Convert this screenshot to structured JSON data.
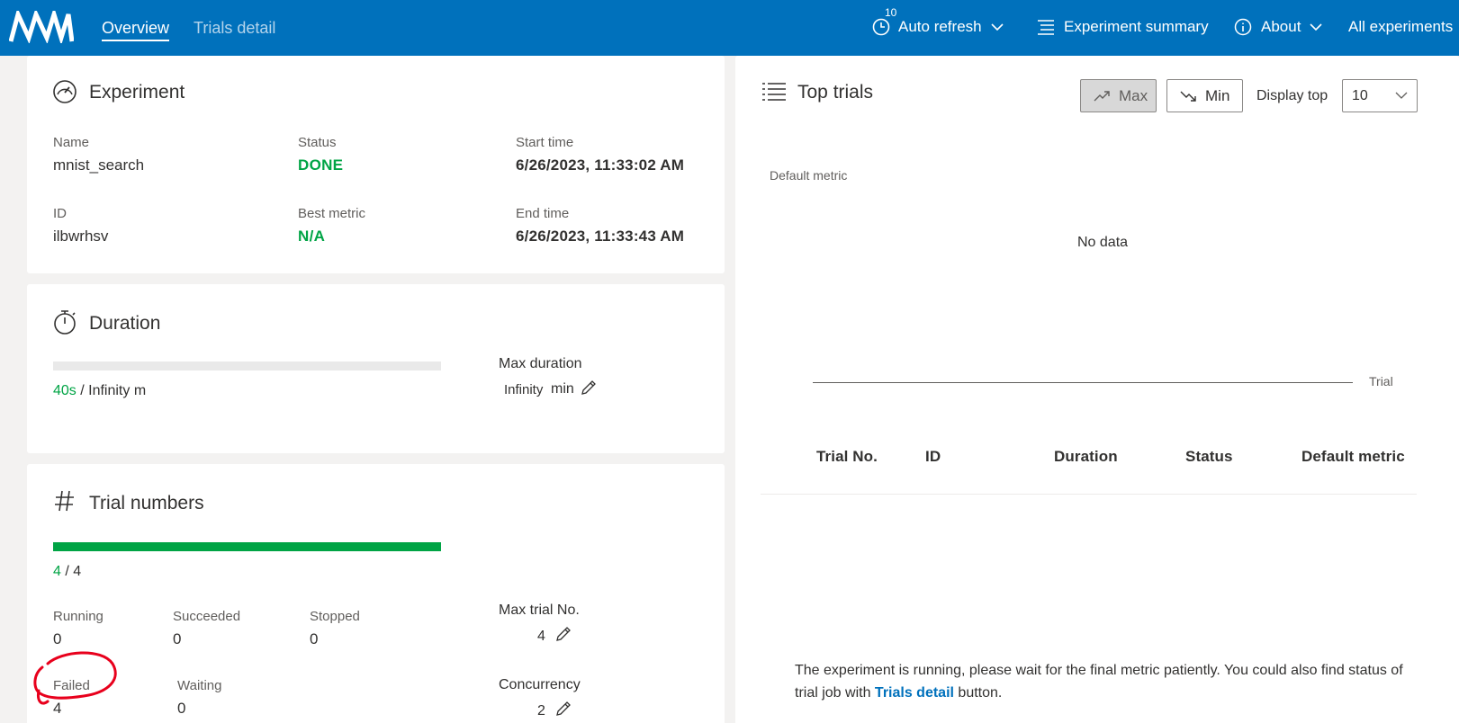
{
  "nav": {
    "tabs": [
      {
        "label": "Overview",
        "active": true
      },
      {
        "label": "Trials detail",
        "active": false
      }
    ],
    "auto_refresh": {
      "label": "Auto refresh",
      "badge": "10",
      "icon": "clock-icon"
    },
    "experiment_summary": {
      "label": "Experiment summary",
      "icon": "list-icon"
    },
    "about": {
      "label": "About",
      "icon": "info-icon"
    },
    "all_experiments": {
      "label": "All experiments"
    },
    "bg_color": "#0071bc"
  },
  "experiment": {
    "title": "Experiment",
    "icon": "gauge-icon",
    "name_label": "Name",
    "name": "mnist_search",
    "status_label": "Status",
    "status": "DONE",
    "start_label": "Start time",
    "start": "6/26/2023, 11:33:02 AM",
    "id_label": "ID",
    "id": "ilbwrhsv",
    "best_label": "Best metric",
    "best": "N/A",
    "end_label": "End time",
    "end": "6/26/2023, 11:33:43 AM"
  },
  "duration": {
    "title": "Duration",
    "icon": "stopwatch-icon",
    "progress_fraction": 0,
    "elapsed": "40s",
    "total": " / Infinity m",
    "max_label": "Max duration",
    "max_value": "Infinity",
    "max_unit": "min"
  },
  "trials": {
    "title": "Trial numbers",
    "icon": "hash-icon",
    "progress_fraction": 1,
    "done": "4",
    "total": " / 4",
    "running_label": "Running",
    "running": "0",
    "succeeded_label": "Succeeded",
    "succeeded": "0",
    "stopped_label": "Stopped",
    "stopped": "0",
    "failed_label": "Failed",
    "failed": "4",
    "waiting_label": "Waiting",
    "waiting": "0",
    "max_label": "Max trial No.",
    "max_value": "4",
    "concurrency_label": "Concurrency",
    "concurrency_value": "2"
  },
  "top_trials": {
    "title": "Top trials",
    "icon": "list-icon",
    "max_label": "Max",
    "min_label": "Min",
    "display_top_label": "Display top",
    "display_top_value": "10",
    "chart_ylabel": "Default metric",
    "chart_empty": "No data",
    "chart_xlabel": "Trial",
    "columns": [
      "Trial No.",
      "ID",
      "Duration",
      "Status",
      "Default metric"
    ],
    "note_text": "The experiment is running, please wait for the final metric patiently. You could also find status of trial job with ",
    "note_link": "Trials detail",
    "note_tail": " button."
  },
  "colors": {
    "accent": "#0071bc",
    "success": "#00a445",
    "annotation": "#e8001c"
  }
}
